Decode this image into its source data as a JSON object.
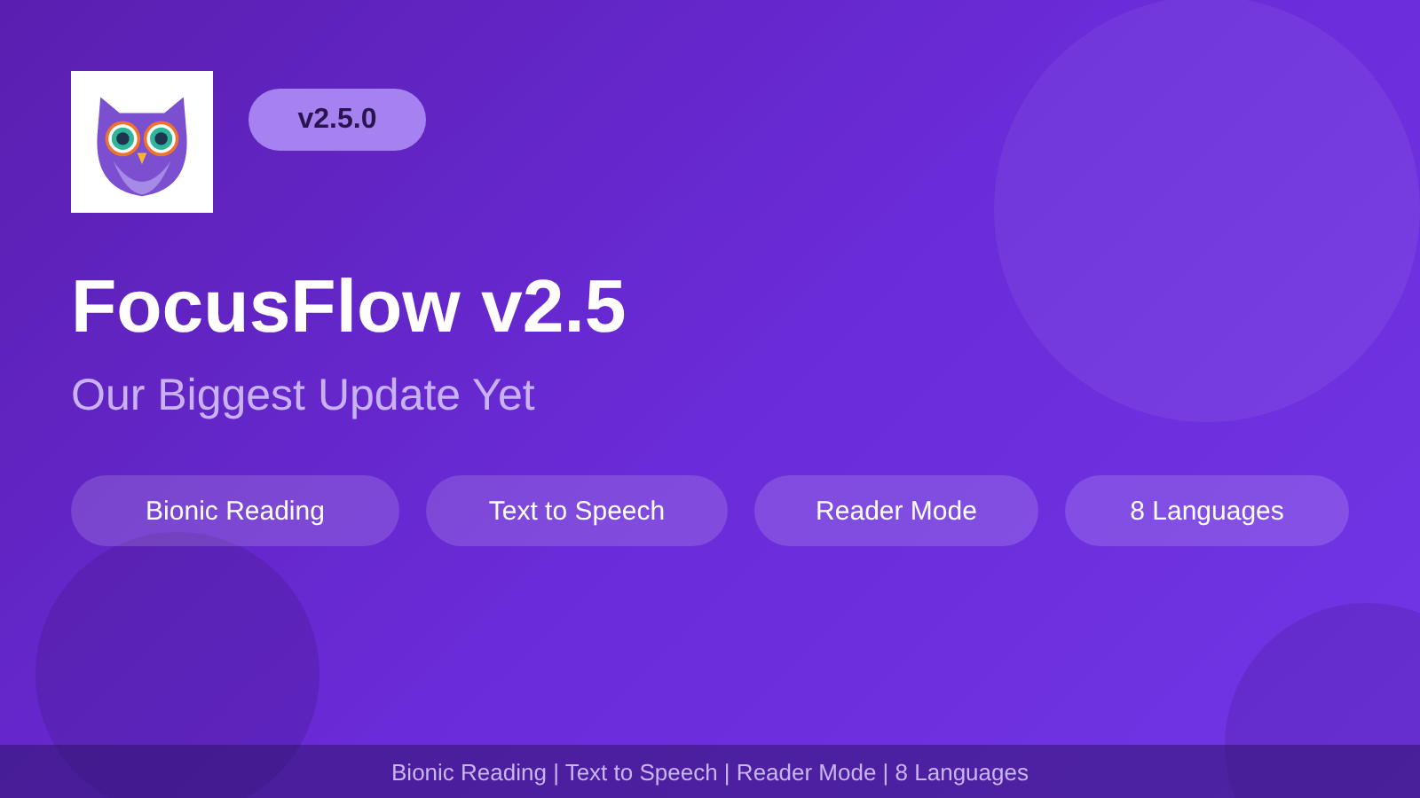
{
  "badge": "v2.5.0",
  "title": "FocusFlow v2.5",
  "subtitle": "Our Biggest Update Yet",
  "features": [
    "Bionic Reading",
    "Text to Speech",
    "Reader Mode",
    "8 Languages"
  ],
  "footer": "Bionic Reading | Text to Speech | Reader Mode | 8 Languages"
}
